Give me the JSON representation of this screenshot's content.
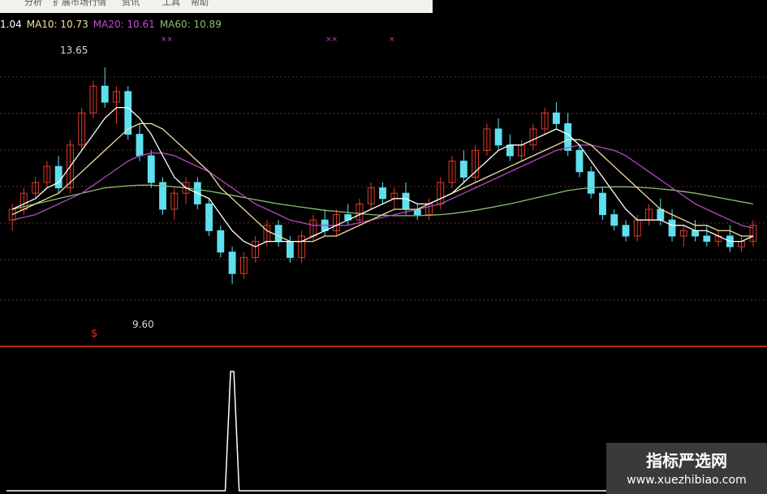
{
  "menu": [
    "",
    "分析",
    "扩展市场行情",
    "资讯",
    "工具",
    "帮助"
  ],
  "legend": {
    "ma5": "1.04",
    "ma10": "MA10: 10.73",
    "ma20": "MA20: 10.61",
    "ma60": "MA60: 10.89"
  },
  "colors": {
    "up": "#e03a2a",
    "down": "#5ee0ee",
    "ma5": "#ffffff",
    "ma10": "#f0e0a0",
    "ma20": "#b048c0",
    "ma60": "#88c070",
    "grid": "#6a2a2a",
    "divider": "#c02020",
    "signal": "#ffffff"
  },
  "annotations": {
    "high_label": "13.65",
    "low_label": "9.60",
    "markers": [
      "××",
      "××",
      "×"
    ],
    "signal_symbol": "$"
  },
  "watermark": {
    "title": "指标严选网",
    "url": "www.xuezhibiao.com"
  },
  "chart_data": {
    "type": "candlestick",
    "candles": [
      [
        10.8,
        11.1,
        10.6,
        11.0
      ],
      [
        11.0,
        11.4,
        10.9,
        11.3
      ],
      [
        11.3,
        11.6,
        11.2,
        11.5
      ],
      [
        11.5,
        11.9,
        11.4,
        11.8
      ],
      [
        11.8,
        12.0,
        11.3,
        11.4
      ],
      [
        11.4,
        12.3,
        11.3,
        12.2
      ],
      [
        12.2,
        12.9,
        12.1,
        12.8
      ],
      [
        12.8,
        13.4,
        12.7,
        13.3
      ],
      [
        13.3,
        13.65,
        12.9,
        13.0
      ],
      [
        13.0,
        13.3,
        12.6,
        13.2
      ],
      [
        13.2,
        13.3,
        12.3,
        12.4
      ],
      [
        12.4,
        12.6,
        11.9,
        12.0
      ],
      [
        12.0,
        12.1,
        11.4,
        11.5
      ],
      [
        11.5,
        11.6,
        10.9,
        11.0
      ],
      [
        11.0,
        11.4,
        10.8,
        11.3
      ],
      [
        11.3,
        11.6,
        11.1,
        11.5
      ],
      [
        11.5,
        11.6,
        11.0,
        11.1
      ],
      [
        11.1,
        11.2,
        10.5,
        10.6
      ],
      [
        10.6,
        10.7,
        10.1,
        10.2
      ],
      [
        10.2,
        10.3,
        9.6,
        9.8
      ],
      [
        9.8,
        10.2,
        9.7,
        10.1
      ],
      [
        10.1,
        10.5,
        10.0,
        10.4
      ],
      [
        10.4,
        10.8,
        10.3,
        10.7
      ],
      [
        10.7,
        10.8,
        10.3,
        10.4
      ],
      [
        10.4,
        10.5,
        10.0,
        10.1
      ],
      [
        10.1,
        10.6,
        10.0,
        10.5
      ],
      [
        10.5,
        10.9,
        10.4,
        10.8
      ],
      [
        10.8,
        11.0,
        10.5,
        10.6
      ],
      [
        10.6,
        11.0,
        10.5,
        10.9
      ],
      [
        10.9,
        11.1,
        10.7,
        10.8
      ],
      [
        10.8,
        11.2,
        10.7,
        11.1
      ],
      [
        11.1,
        11.5,
        11.0,
        11.4
      ],
      [
        11.4,
        11.5,
        11.1,
        11.2
      ],
      [
        11.2,
        11.4,
        11.0,
        11.3
      ],
      [
        11.3,
        11.5,
        10.9,
        11.0
      ],
      [
        11.0,
        11.1,
        10.8,
        10.9
      ],
      [
        10.9,
        11.2,
        10.8,
        11.1
      ],
      [
        11.1,
        11.6,
        11.0,
        11.5
      ],
      [
        11.5,
        12.0,
        11.4,
        11.9
      ],
      [
        11.9,
        12.1,
        11.5,
        11.6
      ],
      [
        11.6,
        12.2,
        11.5,
        12.1
      ],
      [
        12.1,
        12.6,
        12.0,
        12.5
      ],
      [
        12.5,
        12.7,
        12.1,
        12.2
      ],
      [
        12.2,
        12.4,
        11.9,
        12.0
      ],
      [
        12.0,
        12.3,
        11.9,
        12.2
      ],
      [
        12.2,
        12.6,
        12.1,
        12.5
      ],
      [
        12.5,
        12.9,
        12.4,
        12.8
      ],
      [
        12.8,
        13.0,
        12.5,
        12.6
      ],
      [
        12.6,
        12.8,
        12.0,
        12.1
      ],
      [
        12.1,
        12.2,
        11.6,
        11.7
      ],
      [
        11.7,
        11.8,
        11.2,
        11.3
      ],
      [
        11.3,
        11.4,
        10.8,
        10.9
      ],
      [
        10.9,
        11.0,
        10.6,
        10.7
      ],
      [
        10.7,
        10.8,
        10.4,
        10.5
      ],
      [
        10.5,
        10.9,
        10.4,
        10.8
      ],
      [
        10.8,
        11.1,
        10.7,
        11.0
      ],
      [
        11.0,
        11.2,
        10.7,
        10.8
      ],
      [
        10.8,
        11.0,
        10.4,
        10.5
      ],
      [
        10.5,
        10.7,
        10.3,
        10.6
      ],
      [
        10.6,
        10.8,
        10.4,
        10.5
      ],
      [
        10.5,
        10.7,
        10.3,
        10.4
      ],
      [
        10.4,
        10.6,
        10.3,
        10.5
      ],
      [
        10.5,
        10.7,
        10.2,
        10.3
      ],
      [
        10.3,
        10.5,
        10.2,
        10.4
      ],
      [
        10.4,
        10.8,
        10.3,
        10.7
      ]
    ],
    "ma5": [
      11.0,
      11.1,
      11.2,
      11.4,
      11.5,
      11.8,
      12.1,
      12.4,
      12.7,
      12.9,
      12.9,
      12.7,
      12.4,
      12.0,
      11.6,
      11.4,
      11.3,
      11.2,
      10.9,
      10.6,
      10.4,
      10.3,
      10.4,
      10.4,
      10.4,
      10.4,
      10.5,
      10.6,
      10.7,
      10.8,
      10.9,
      11.0,
      11.1,
      11.2,
      11.2,
      11.1,
      11.1,
      11.2,
      11.3,
      11.5,
      11.7,
      11.9,
      12.1,
      12.2,
      12.2,
      12.3,
      12.4,
      12.5,
      12.4,
      12.2,
      11.9,
      11.6,
      11.3,
      11.0,
      10.8,
      10.8,
      10.8,
      10.7,
      10.7,
      10.6,
      10.6,
      10.5,
      10.4,
      10.4,
      10.5
    ],
    "ma10": [
      10.9,
      11.0,
      11.1,
      11.2,
      11.3,
      11.5,
      11.7,
      11.9,
      12.1,
      12.3,
      12.5,
      12.6,
      12.6,
      12.5,
      12.3,
      12.1,
      11.9,
      11.7,
      11.4,
      11.2,
      11.0,
      10.8,
      10.6,
      10.5,
      10.4,
      10.4,
      10.4,
      10.5,
      10.5,
      10.6,
      10.7,
      10.8,
      10.9,
      11.0,
      11.0,
      11.0,
      11.1,
      11.2,
      11.3,
      11.4,
      11.5,
      11.6,
      11.7,
      11.8,
      11.9,
      12.0,
      12.1,
      12.2,
      12.3,
      12.3,
      12.2,
      12.0,
      11.8,
      11.6,
      11.4,
      11.2,
      11.0,
      10.9,
      10.8,
      10.7,
      10.7,
      10.6,
      10.6,
      10.5,
      10.5
    ],
    "ma20": [
      10.8,
      10.85,
      10.9,
      11.0,
      11.1,
      11.2,
      11.3,
      11.45,
      11.6,
      11.75,
      11.9,
      12.0,
      12.05,
      12.05,
      12.0,
      11.9,
      11.8,
      11.7,
      11.55,
      11.4,
      11.25,
      11.1,
      11.0,
      10.9,
      10.8,
      10.75,
      10.7,
      10.7,
      10.7,
      10.7,
      10.75,
      10.8,
      10.85,
      10.9,
      10.95,
      11.0,
      11.05,
      11.1,
      11.2,
      11.3,
      11.4,
      11.5,
      11.6,
      11.7,
      11.8,
      11.9,
      12.0,
      12.1,
      12.15,
      12.2,
      12.2,
      12.15,
      12.1,
      12.0,
      11.85,
      11.7,
      11.55,
      11.4,
      11.25,
      11.1,
      11.0,
      10.9,
      10.8,
      10.7,
      10.65
    ],
    "ma60": [
      11.0,
      11.05,
      11.1,
      11.15,
      11.2,
      11.25,
      11.3,
      11.35,
      11.4,
      11.42,
      11.44,
      11.45,
      11.45,
      11.44,
      11.42,
      11.4,
      11.37,
      11.34,
      11.3,
      11.26,
      11.22,
      11.18,
      11.14,
      11.1,
      11.07,
      11.04,
      11.01,
      10.98,
      10.96,
      10.94,
      10.92,
      10.9,
      10.89,
      10.88,
      10.88,
      10.88,
      10.89,
      10.9,
      10.92,
      10.95,
      10.98,
      11.02,
      11.06,
      11.1,
      11.15,
      11.2,
      11.25,
      11.3,
      11.35,
      11.38,
      11.4,
      11.41,
      11.42,
      11.42,
      11.41,
      11.4,
      11.38,
      11.36,
      11.33,
      11.3,
      11.26,
      11.22,
      11.18,
      11.14,
      11.1
    ],
    "signal": [
      0,
      0,
      0,
      0,
      0,
      0,
      0,
      0,
      0,
      0,
      0,
      0,
      0,
      0,
      0,
      0,
      0,
      0,
      0,
      1,
      0,
      0,
      0,
      0,
      0,
      0,
      0,
      0,
      0,
      0,
      0,
      0,
      0,
      0,
      0,
      0,
      0,
      0,
      0,
      0,
      0,
      0,
      0,
      0,
      0,
      0,
      0,
      0,
      0,
      0,
      0,
      0,
      0,
      0,
      0,
      0,
      0,
      0,
      0,
      0,
      0,
      0,
      0,
      0,
      0
    ],
    "ylim": [
      9.0,
      14.0
    ]
  }
}
